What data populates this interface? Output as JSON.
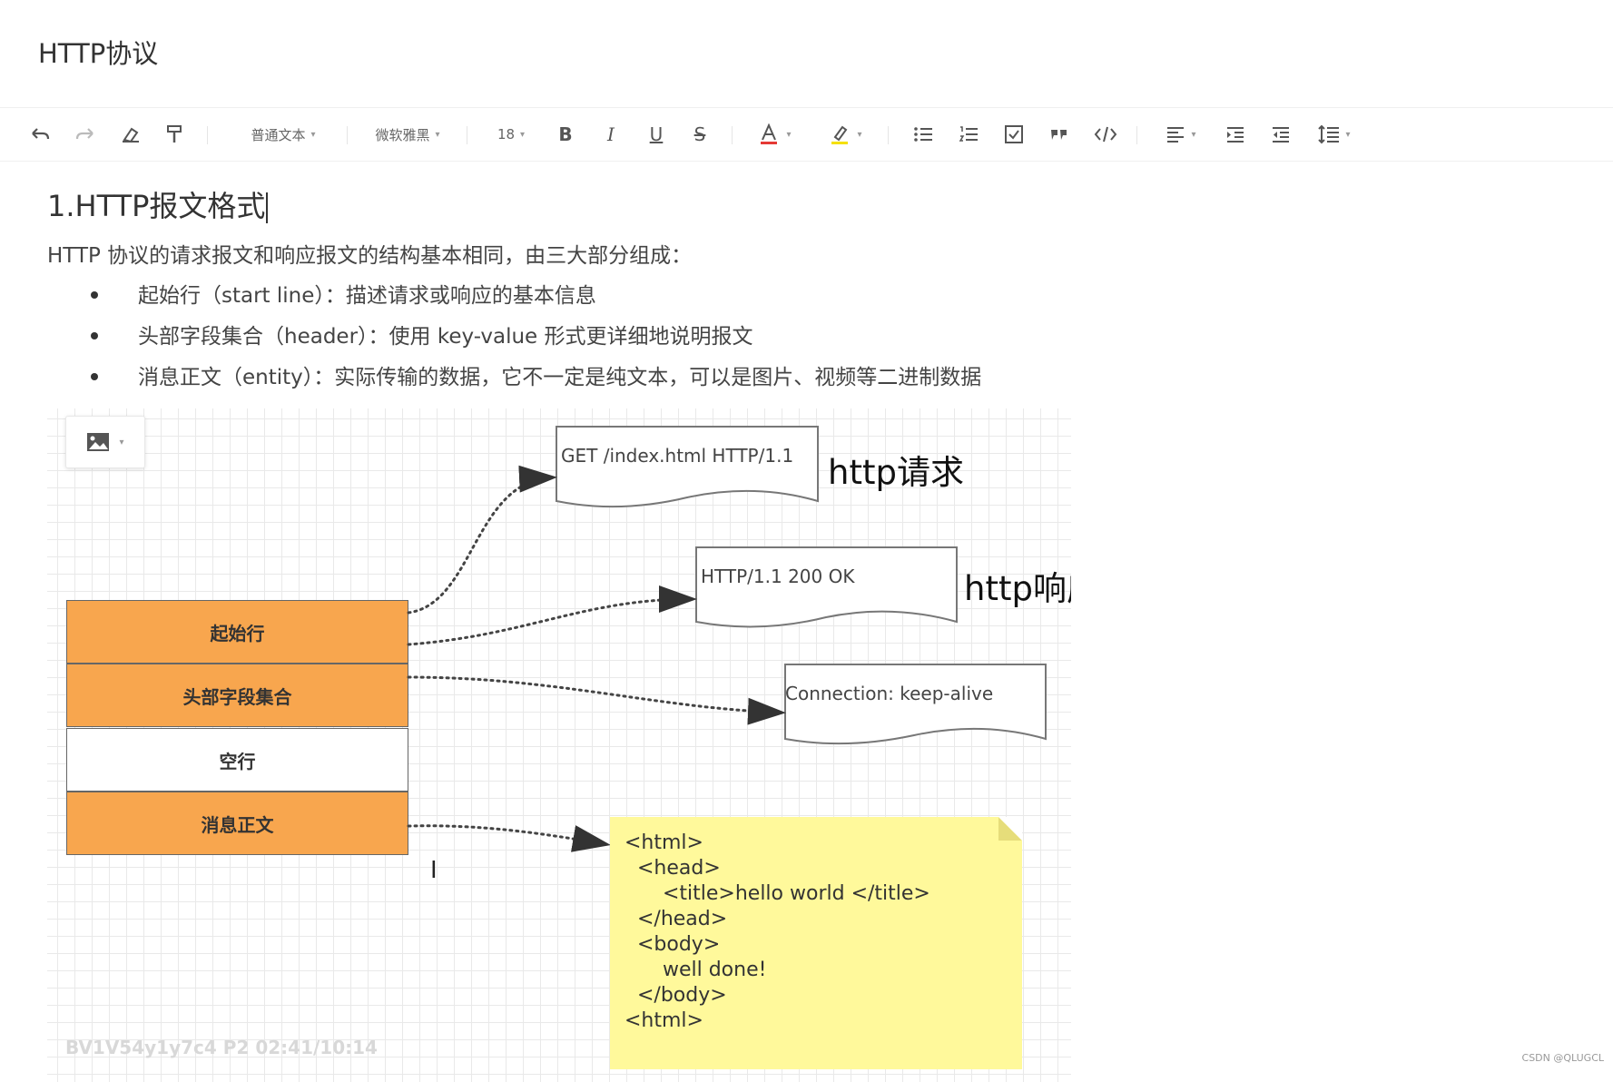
{
  "doc": {
    "title": "HTTP协议"
  },
  "toolbar": {
    "paragraph_style": "普通文本",
    "font_family": "微软雅黑",
    "font_size": "18",
    "caret": "▾"
  },
  "content": {
    "heading": "1.HTTP报文格式",
    "intro": "HTTP 协议的请求报文和响应报文的结构基本相同，由三大部分组成：",
    "bullets": [
      "起始行（start line）：描述请求或响应的基本信息",
      "头部字段集合（header）：使用 key-value 形式更详细地说明报文",
      "消息正文（entity）：实际传输的数据，它不一定是纯文本，可以是图片、视频等二进制数据"
    ]
  },
  "diagram": {
    "segments": [
      {
        "label": "起始行",
        "fill": "#f8a64e"
      },
      {
        "label": "头部字段集合",
        "fill": "#f8a64e"
      },
      {
        "label": "空行",
        "fill": "#ffffff"
      },
      {
        "label": "消息正文",
        "fill": "#f8a64e"
      }
    ],
    "request_line": "GET /index.html HTTP/1.1",
    "request_label": "http请求",
    "response_line": "HTTP/1.1 200 OK",
    "response_label": "http响应",
    "header_line": "Connection: keep-alive",
    "body_note": {
      "lines": [
        "<html>",
        "  <head>",
        "      <title>hello world </title>",
        "  </head>",
        "  <body>",
        "      well done!",
        "  </body>",
        "<html>"
      ],
      "fill": "#fff99b"
    }
  },
  "overlay": {
    "watermark": "BV1V54y1y7c4 P2 02:41/10:14",
    "csdn": "CSDN @QLUGCL",
    "text_cursor": "I"
  },
  "colors": {
    "accent_orange": "#f8a64e",
    "note_yellow": "#fff99b",
    "grid": "#e9e9e9"
  }
}
